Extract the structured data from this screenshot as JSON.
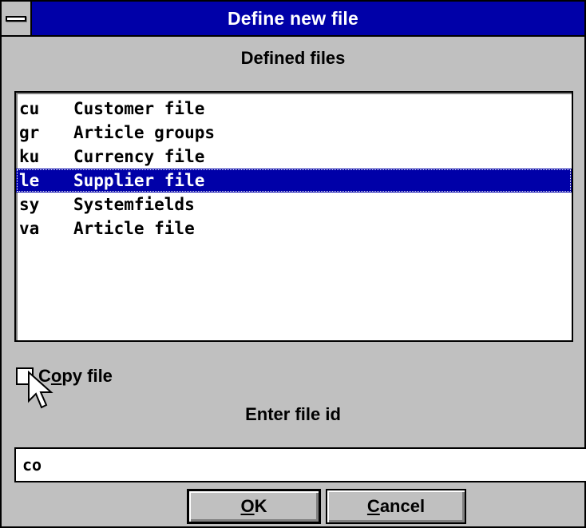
{
  "window": {
    "title": "Define new file"
  },
  "defined_files": {
    "label": "Defined files",
    "items": [
      {
        "code": "cu",
        "name": "Customer file",
        "selected": false
      },
      {
        "code": "gr",
        "name": "Article groups",
        "selected": false
      },
      {
        "code": "ku",
        "name": "Currency file",
        "selected": false
      },
      {
        "code": "le",
        "name": "Supplier file",
        "selected": true
      },
      {
        "code": "sy",
        "name": "Systemfields",
        "selected": false
      },
      {
        "code": "va",
        "name": "Article file",
        "selected": false
      }
    ]
  },
  "copy_file": {
    "label_pre": "C",
    "label_accel": "o",
    "label_post": "py file",
    "checked": false
  },
  "file_id": {
    "label": "Enter file id",
    "value": "co"
  },
  "buttons": {
    "ok_accel": "O",
    "ok_rest": "K",
    "cancel_accel": "C",
    "cancel_rest": "ancel"
  },
  "colors": {
    "titlebar": "#0000a8",
    "selection": "#0000a8",
    "face": "#c0c0c0"
  },
  "icons": {
    "system_menu": "system-menu-icon",
    "cursor": "mouse-pointer-icon"
  }
}
